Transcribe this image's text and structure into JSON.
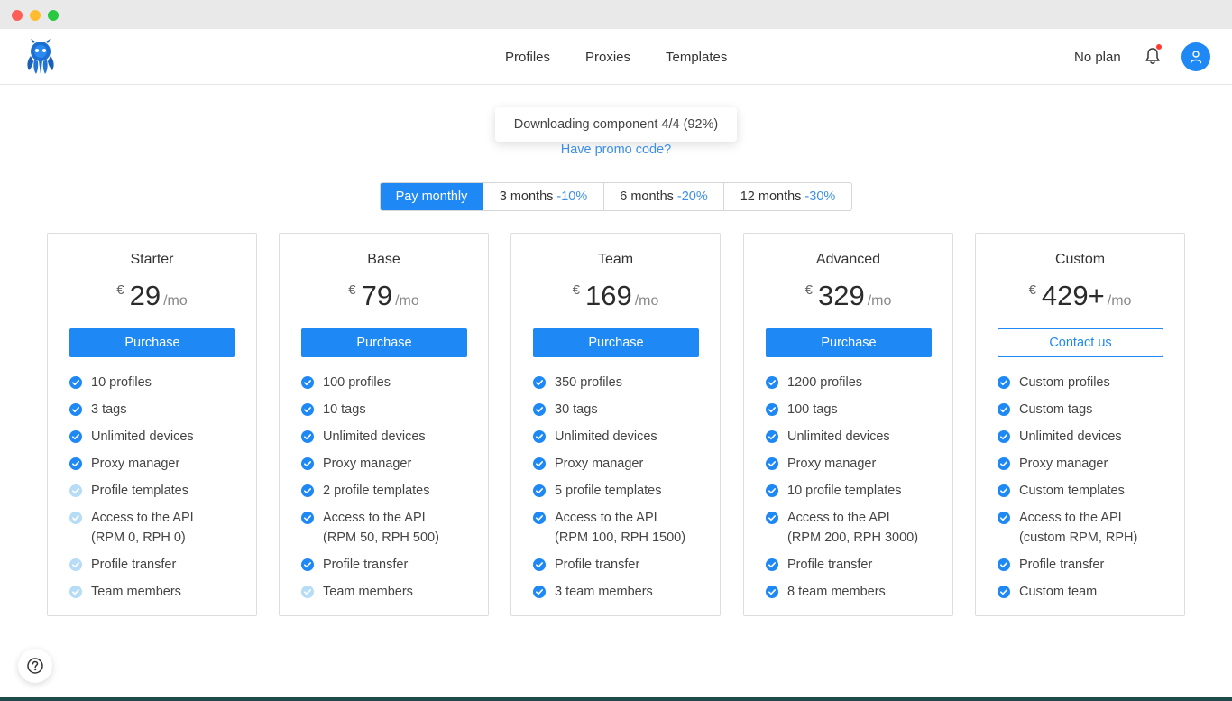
{
  "nav": {
    "profiles": "Profiles",
    "proxies": "Proxies",
    "templates": "Templates"
  },
  "header": {
    "plan": "No plan"
  },
  "toast": "Downloading component 4/4 (92%)",
  "promo": "Have promo code?",
  "periods": [
    {
      "label": "Pay monthly",
      "discount": ""
    },
    {
      "label": "3 months",
      "discount": "-10%"
    },
    {
      "label": "6 months",
      "discount": "-20%"
    },
    {
      "label": "12 months",
      "discount": "-30%"
    }
  ],
  "currency": "€",
  "per": "/mo",
  "plans": [
    {
      "name": "Starter",
      "price": "29",
      "button": "Purchase",
      "features": [
        {
          "text": "10 profiles",
          "enabled": true
        },
        {
          "text": "3 tags",
          "enabled": true
        },
        {
          "text": "Unlimited devices",
          "enabled": true
        },
        {
          "text": "Proxy manager",
          "enabled": true
        },
        {
          "text": "Profile templates",
          "enabled": false
        },
        {
          "text": "Access to the API (RPM 0, RPH 0)",
          "enabled": false
        },
        {
          "text": "Profile transfer",
          "enabled": false
        },
        {
          "text": "Team members",
          "enabled": false
        }
      ]
    },
    {
      "name": "Base",
      "price": "79",
      "button": "Purchase",
      "features": [
        {
          "text": "100 profiles",
          "enabled": true
        },
        {
          "text": "10 tags",
          "enabled": true
        },
        {
          "text": "Unlimited devices",
          "enabled": true
        },
        {
          "text": "Proxy manager",
          "enabled": true
        },
        {
          "text": "2 profile templates",
          "enabled": true
        },
        {
          "text": "Access to the API (RPM 50, RPH 500)",
          "enabled": true
        },
        {
          "text": "Profile transfer",
          "enabled": true
        },
        {
          "text": "Team members",
          "enabled": false
        }
      ]
    },
    {
      "name": "Team",
      "price": "169",
      "button": "Purchase",
      "features": [
        {
          "text": "350 profiles",
          "enabled": true
        },
        {
          "text": "30 tags",
          "enabled": true
        },
        {
          "text": "Unlimited devices",
          "enabled": true
        },
        {
          "text": "Proxy manager",
          "enabled": true
        },
        {
          "text": "5 profile templates",
          "enabled": true
        },
        {
          "text": "Access to the API (RPM 100, RPH 1500)",
          "enabled": true
        },
        {
          "text": "Profile transfer",
          "enabled": true
        },
        {
          "text": "3 team members",
          "enabled": true
        }
      ]
    },
    {
      "name": "Advanced",
      "price": "329",
      "button": "Purchase",
      "features": [
        {
          "text": "1200 profiles",
          "enabled": true
        },
        {
          "text": "100 tags",
          "enabled": true
        },
        {
          "text": "Unlimited devices",
          "enabled": true
        },
        {
          "text": "Proxy manager",
          "enabled": true
        },
        {
          "text": "10 profile templates",
          "enabled": true
        },
        {
          "text": "Access to the API (RPM 200, RPH 3000)",
          "enabled": true
        },
        {
          "text": "Profile transfer",
          "enabled": true
        },
        {
          "text": "8 team members",
          "enabled": true
        }
      ]
    },
    {
      "name": "Custom",
      "price": "429+",
      "button": "Contact us",
      "features": [
        {
          "text": "Custom profiles",
          "enabled": true
        },
        {
          "text": "Custom tags",
          "enabled": true
        },
        {
          "text": "Unlimited devices",
          "enabled": true
        },
        {
          "text": "Proxy manager",
          "enabled": true
        },
        {
          "text": "Custom templates",
          "enabled": true
        },
        {
          "text": "Access to the API (custom RPM, RPH)",
          "enabled": true
        },
        {
          "text": "Profile transfer",
          "enabled": true
        },
        {
          "text": "Custom team",
          "enabled": true
        }
      ]
    }
  ],
  "colors": {
    "accent": "#1e88f5",
    "link": "#3c8ee6",
    "check_disabled": "#b7dcf7",
    "notification": "#ff3b30"
  },
  "icons": {
    "logo": "octopus-logo-icon",
    "bell": "bell-icon",
    "avatar": "user-icon",
    "help": "help-icon",
    "check": "check-icon"
  }
}
